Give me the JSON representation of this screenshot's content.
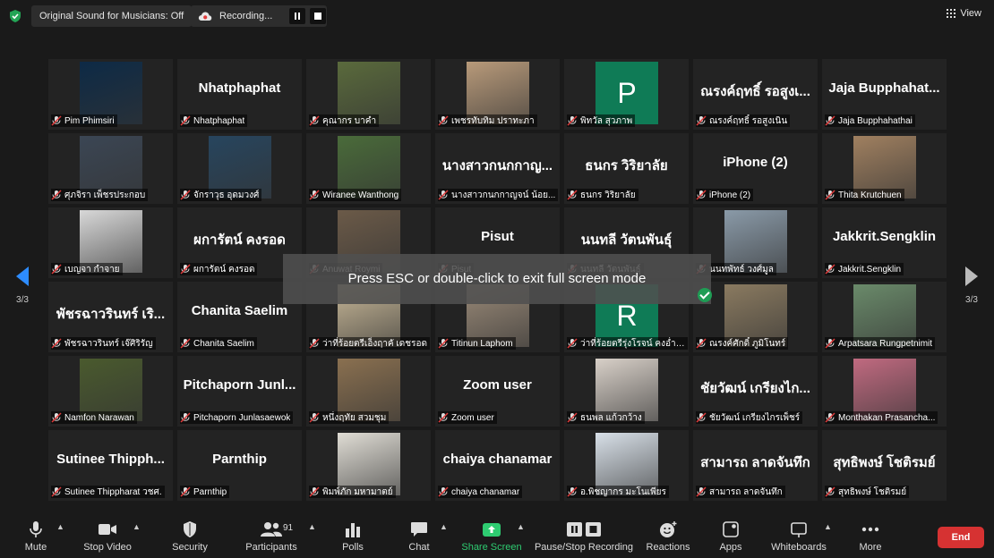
{
  "topbar": {
    "sound_label": "Original Sound for Musicians: Off",
    "recording_label": "Recording...",
    "view_label": "View"
  },
  "nav": {
    "left_page": "3/3",
    "right_page": "3/3"
  },
  "toast": "Press ESC or double-click to exit full screen mode",
  "tiles": [
    {
      "kind": "photo",
      "label": "Pim Phimsiri",
      "color": "#0d2a46"
    },
    {
      "kind": "text",
      "big": "Nhatphaphat",
      "label": "Nhatphaphat"
    },
    {
      "kind": "photo",
      "label": "คุณากร บาคำ",
      "color": "#5a6a3c"
    },
    {
      "kind": "photo",
      "label": "เพชรทับทิม ปราทะภา",
      "color": "#b89a7a"
    },
    {
      "kind": "letter",
      "letter": "P",
      "label": "พิทวัล สุวภาพ"
    },
    {
      "kind": "text",
      "big": "ณรงค์ฤทธิ์ รอสูงเ...",
      "label": "ณรงค์ฤทธิ์ รอสูงเนิน"
    },
    {
      "kind": "text",
      "big": "Jaja Bupphahat...",
      "label": "Jaja Bupphahathai"
    },
    {
      "kind": "photo",
      "label": "ศุภจิรา เพ็ชรประกอบ",
      "color": "#3b4654"
    },
    {
      "kind": "photo",
      "label": "จักราวุธ อุดมวงศ์",
      "color": "#27455e"
    },
    {
      "kind": "photo",
      "label": "Wiranee Wanthong",
      "color": "#4a6b3a"
    },
    {
      "kind": "text",
      "big": "นางสาวกนกกาญ...",
      "label": "นางสาวกนกกาญจน์ น้อย..."
    },
    {
      "kind": "text",
      "big": "ธนกร วิริยาลัย",
      "label": "ธนกร วิริยาลัย"
    },
    {
      "kind": "text",
      "big": "iPhone (2)",
      "label": "iPhone (2)"
    },
    {
      "kind": "photo",
      "label": "Thita Krutchuen",
      "color": "#a08060"
    },
    {
      "kind": "photo",
      "label": "เบญจา กำจาย",
      "color": "#d8d8d8"
    },
    {
      "kind": "text",
      "big": "ผการัตน์ คงรอด",
      "label": "ผการัตน์ คงรอด"
    },
    {
      "kind": "photo",
      "label": "Anuwat Roymi",
      "color": "#6b5a48"
    },
    {
      "kind": "text",
      "big": "Pisut",
      "label": "Pisut"
    },
    {
      "kind": "text",
      "big": "นนทลี วัตนพันธุ์",
      "label": "นนทลี วัตนพันธุ์"
    },
    {
      "kind": "photo",
      "label": "นนทพัทธ์ วงศ์มูล",
      "color": "#8a9aa8"
    },
    {
      "kind": "text",
      "big": "Jakkrit.Sengklin",
      "label": "Jakkrit.Sengklin"
    },
    {
      "kind": "text",
      "big": "พัชรฉาวรินทร์ เริ...",
      "label": "พัชรฉาวรินทร์ เจ๊ศิริรัญ"
    },
    {
      "kind": "text",
      "big": "Chanita Saelim",
      "label": "Chanita Saelim"
    },
    {
      "kind": "photo",
      "label": "ว่าที่ร้อยตรีเอ็งฤาคั เดชรอด",
      "color": "#c8b898"
    },
    {
      "kind": "photo",
      "label": "Titinun Laphom",
      "color": "#9a8a78"
    },
    {
      "kind": "letter",
      "letter": "R",
      "label": "ว่าที่ร้อยตรีรุ่งโรจน์ คงอ่ำนว..."
    },
    {
      "kind": "photo",
      "label": "ณรงค์ศักดิ์ ภูมิโนทร์",
      "color": "#8a7a60"
    },
    {
      "kind": "photo",
      "label": "Arpatsara Rungpetnimit",
      "color": "#6a8a6a"
    },
    {
      "kind": "photo",
      "label": "Namfon Narawan",
      "color": "#4a5a2e"
    },
    {
      "kind": "text",
      "big": "Pitchaporn Junl...",
      "label": "Pitchaporn Junlasaewok"
    },
    {
      "kind": "photo",
      "label": "หนึ่งฤทัย สวมชุม",
      "color": "#8a7050"
    },
    {
      "kind": "text",
      "big": "Zoom user",
      "label": "Zoom user"
    },
    {
      "kind": "photo",
      "label": "ธนพล แก้วกว้าง",
      "color": "#d8d0c8"
    },
    {
      "kind": "text",
      "big": "ชัยวัฒน์ เกรียงไก...",
      "label": "ชัยวัฒน์ เกรียงไกรเพ็ชร์"
    },
    {
      "kind": "photo",
      "label": "Monthakan Prasancha...",
      "color": "#c06a80"
    },
    {
      "kind": "text",
      "big": "Sutinee Thipph...",
      "label": "Sutinee Thippharat วชศ."
    },
    {
      "kind": "text",
      "big": "Parnthip",
      "label": "Parnthip"
    },
    {
      "kind": "photo",
      "label": "พิมพ์ภัก มหามาตย์",
      "color": "#e0ddd5"
    },
    {
      "kind": "text",
      "big": "chaiya chanamar",
      "label": "chaiya chanamar"
    },
    {
      "kind": "photo",
      "label": "อ.พิชญากร มะโนเพียร",
      "color": "#d8e0e8"
    },
    {
      "kind": "text",
      "big": "สามารถ ลาดจันทึก",
      "label": "สามารถ ลาดจันทึก"
    },
    {
      "kind": "text",
      "big": "สุทธิพงษ์ โชติรมย์",
      "label": "สุทธิพงษ์ โชติรมย์"
    }
  ],
  "toolbar": {
    "mute": "Mute",
    "stop_video": "Stop Video",
    "security": "Security",
    "participants": "Participants",
    "participants_count": "91",
    "polls": "Polls",
    "chat": "Chat",
    "share_screen": "Share Screen",
    "pause_stop_recording": "Pause/Stop Recording",
    "reactions": "Reactions",
    "apps": "Apps",
    "whiteboards": "Whiteboards",
    "more": "More",
    "end": "End"
  },
  "colors": {
    "share_green": "#2ecc71",
    "end_red": "#d63232",
    "nav_blue": "#2d8cff",
    "muted_red": "#e03b3b"
  }
}
